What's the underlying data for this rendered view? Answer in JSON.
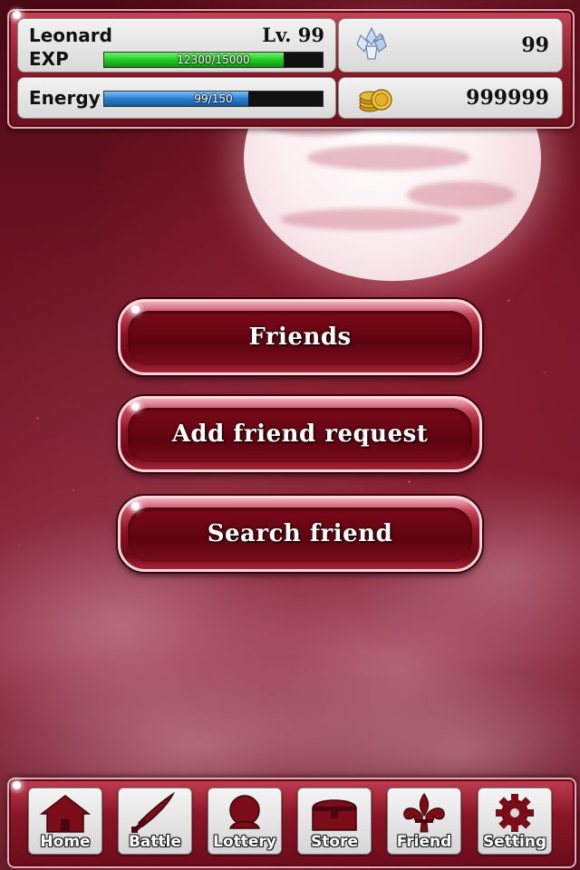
{
  "player": {
    "name": "Leonard",
    "level_text": "Lv. 99",
    "exp_label": "EXP",
    "exp_text": "12300/15000",
    "exp_progress": 0.82,
    "energy_label": "Energy",
    "energy_text": "99/150",
    "energy_progress": 0.66
  },
  "currency": {
    "crystals": "99",
    "coins": "999999"
  },
  "menu": {
    "friends_label": "Friends",
    "add_request_label": "Add friend request",
    "search_label": "Search friend"
  },
  "nav": {
    "items": [
      {
        "label": "Home",
        "icon": "house-icon"
      },
      {
        "label": "Battle",
        "icon": "sword-icon"
      },
      {
        "label": "Lottery",
        "icon": "lottery-icon"
      },
      {
        "label": "Store",
        "icon": "chest-icon"
      },
      {
        "label": "Friend",
        "icon": "fleur-de-lis-icon"
      },
      {
        "label": "Setting",
        "icon": "gear-icon"
      }
    ]
  },
  "colors": {
    "theme_red": "#8a1627",
    "exp_bar": "#22cc22",
    "energy_bar": "#2a7fd0",
    "icon_dark_red": "#7a0d18"
  }
}
